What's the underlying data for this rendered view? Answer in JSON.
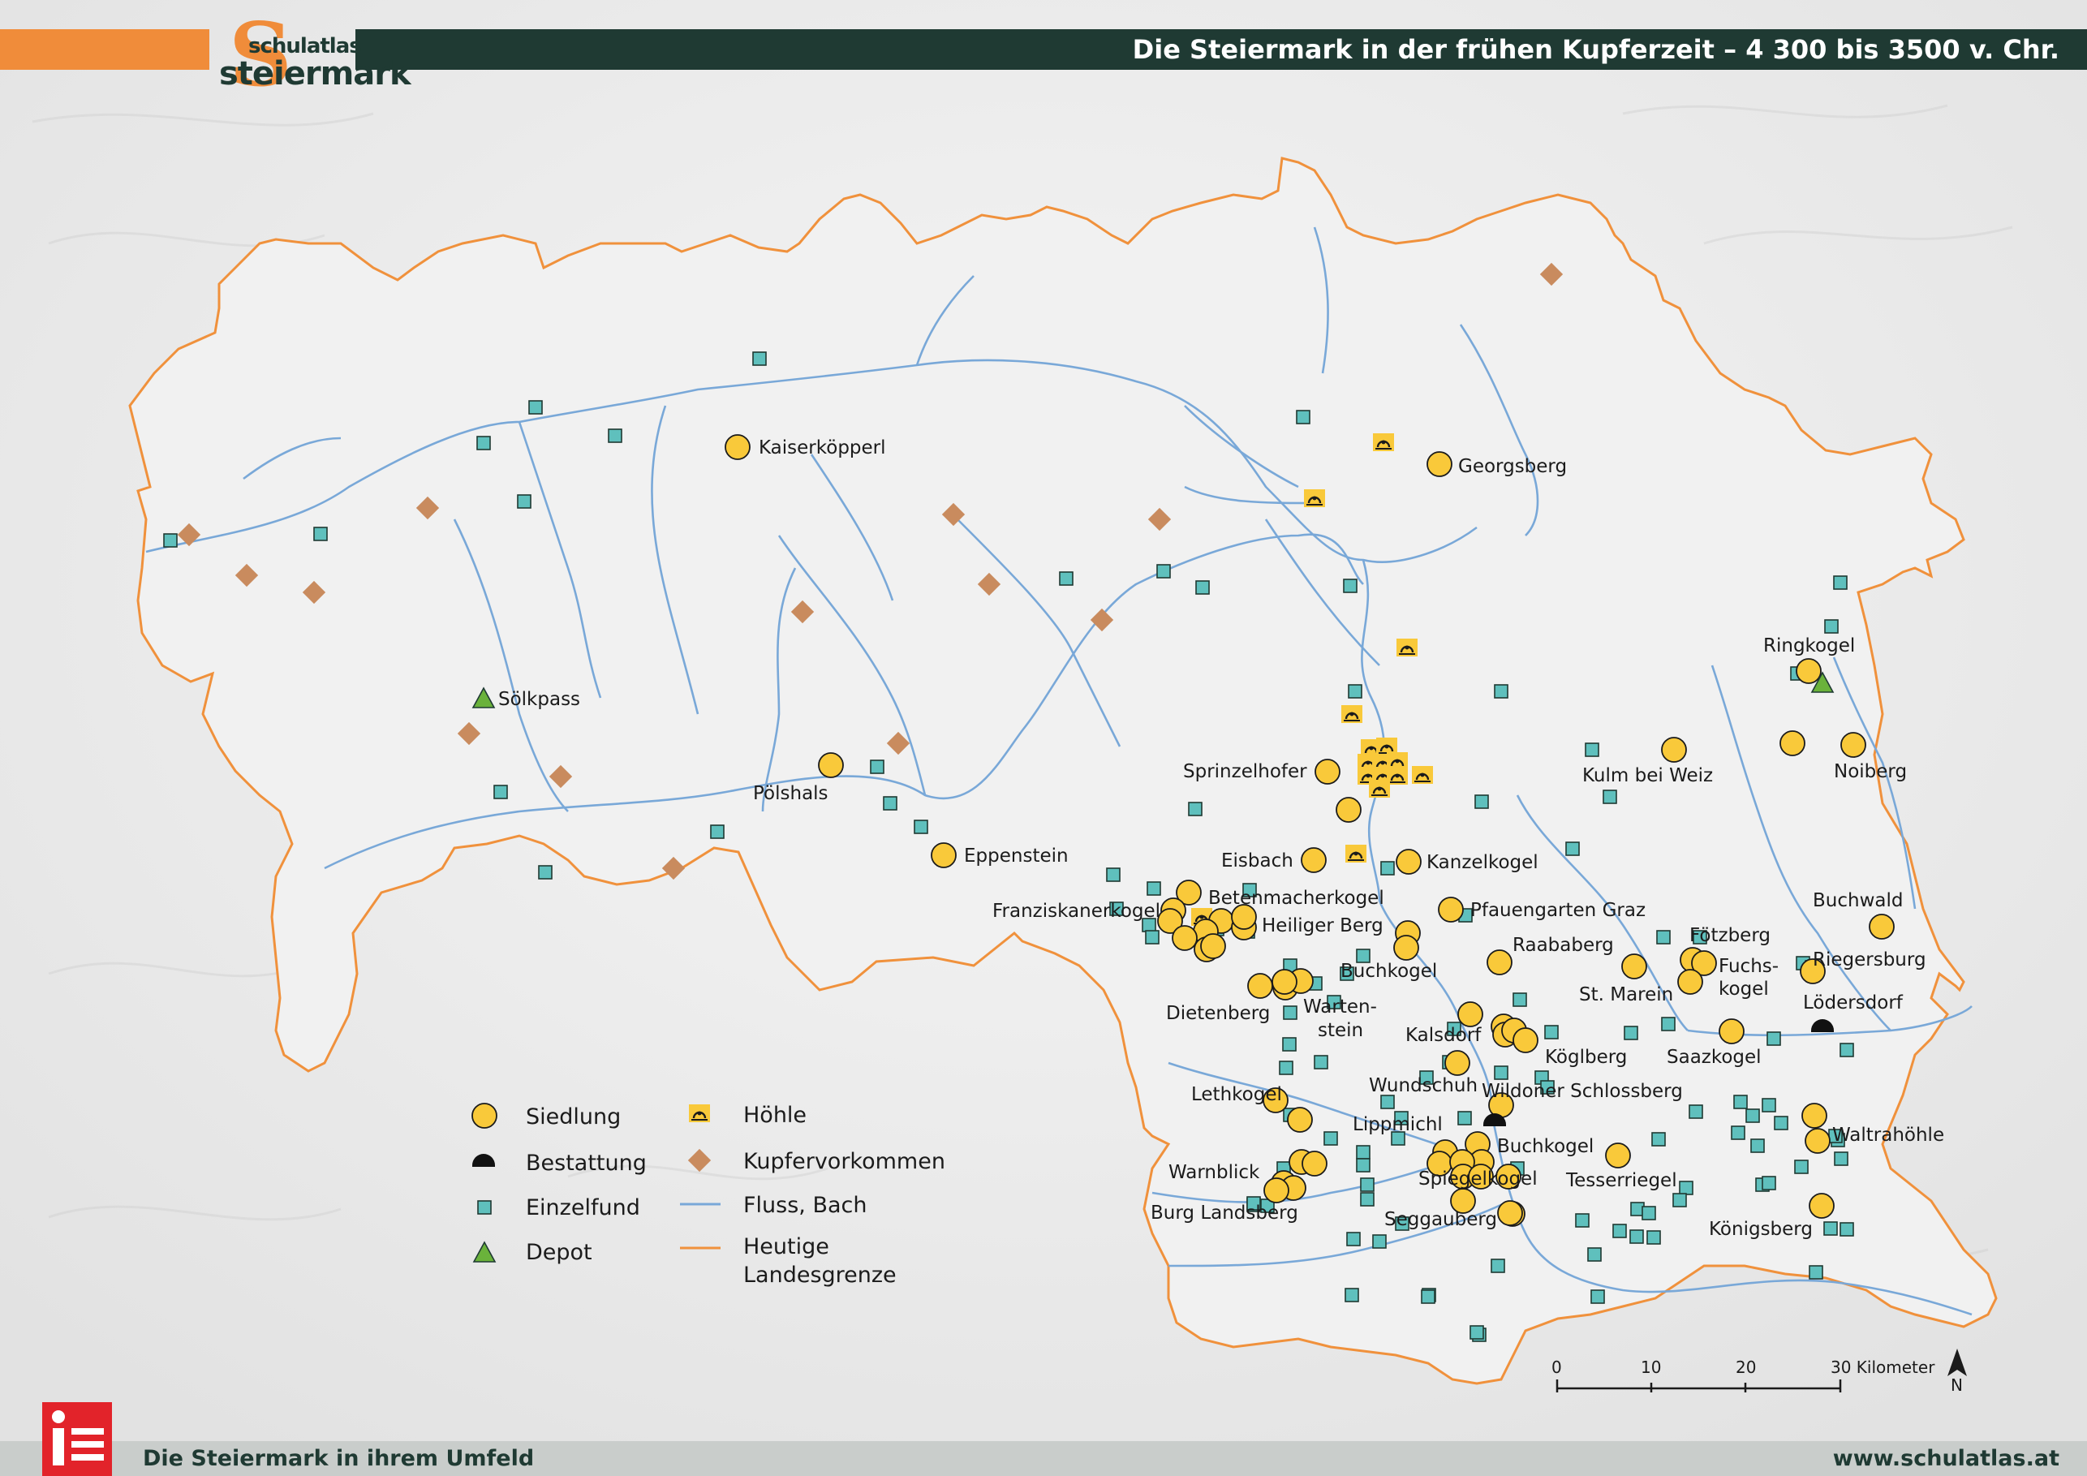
{
  "header": {
    "title": "Die Steiermark in der frühen Kupferzeit – 4 300 bis 3500 v. Chr.",
    "logo_small": "schulatlas",
    "logo_big": "steiermark",
    "logo_letter": "S"
  },
  "footer": {
    "left": "Die Steiermark in ihrem Umfeld",
    "right": "www.schulatlas.at"
  },
  "colors": {
    "orange": "#f08c3a",
    "dark_green": "#1f3a33",
    "settlement": "#f9c93a",
    "single_find": "#5fc0bd",
    "copper": "#c98b5e",
    "depot": "#6ab23b",
    "river": "#79a8d8",
    "border": "#f0913c",
    "footer_icon": "#e2232a"
  },
  "legend": {
    "settlement": "Siedlung",
    "burial": "Bestattung",
    "single_find": "Einzelfund",
    "depot": "Depot",
    "cave": "Höhle",
    "copper": "Kupfervorkommen",
    "river": "Fluss, Bach",
    "border_line1": "Heutige",
    "border_line2": "Landesgrenze"
  },
  "scale": {
    "ticks": [
      "0",
      "10",
      "20",
      "30 Kilometer"
    ],
    "north": "N"
  },
  "place_labels": {
    "kaiserkoepperl": "Kaiserköpperl",
    "georgsberg": "Georgsberg",
    "soelkpass": "Sölkpass",
    "poelshals": "Pölshals",
    "eppenstein": "Eppenstein",
    "sprinzelhofer": "Sprinzelhofer",
    "eisbach": "Eisbach",
    "kanzelkogel": "Kanzelkogel",
    "betenmacherkogel": "Betenmacherkogel",
    "franziskanerkogel": "Franziskanerkogel",
    "heiliger_berg": "Heiliger Berg",
    "pfauengarten": "Pfauengarten Graz",
    "buchkogel1": "Buchkogel",
    "raababerg": "Raababerg",
    "dietenberg": "Dietenberg",
    "warten": "Warten-",
    "stein": "stein",
    "kalsdorf": "Kalsdorf",
    "koeglberg": "Köglberg",
    "wundschuh": "Wundschuh",
    "wildoner": "Wildoner Schlossberg",
    "lethkogel": "Lethkogel",
    "lippmichl": "Lippmichl",
    "buchkogel2": "Buchkogel",
    "warnblick": "Warnblick",
    "spiegelkogel": "Spiegelkogel",
    "tesserriegel": "Tesserriegel",
    "burg_landsberg": "Burg Landsberg",
    "seggauberg": "Seggauberg",
    "kulm": "Kulm bei Weiz",
    "ringkogel": "Ringkogel",
    "noiberg": "Noiberg",
    "buchwald": "Buchwald",
    "foetzberg": "Fötzberg",
    "st_marein": "St. Marein",
    "fuchs": "Fuchs-",
    "kogel": "kogel",
    "riegersburg": "Riegersburg",
    "loedersdorf": "Lödersdorf",
    "saazkogel": "Saazkogel",
    "waltrahoehle": "Waltrahöhle",
    "koenigsberg": "Königsberg"
  }
}
